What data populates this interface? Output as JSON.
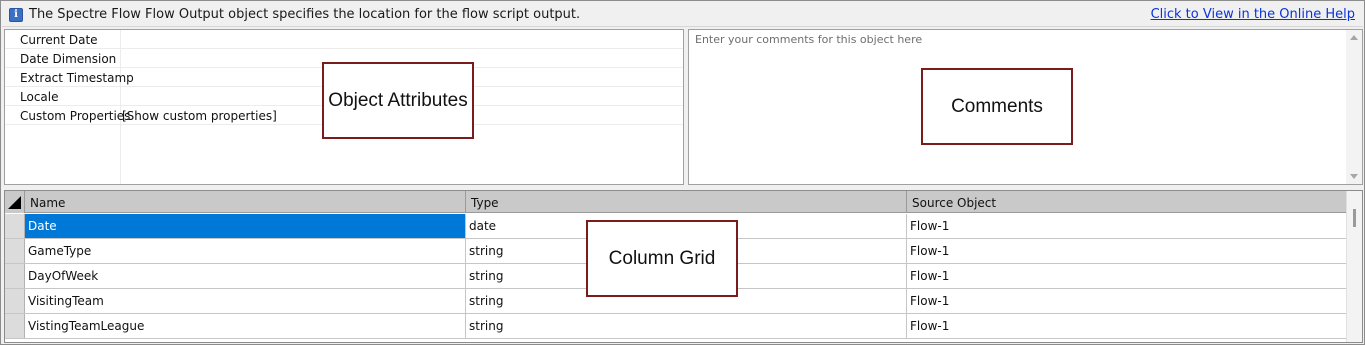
{
  "infobar": {
    "icon": "info-icon",
    "message": "The Spectre Flow Flow Output object specifies the location for the flow script output.",
    "help_link": "Click to View in the Online Help"
  },
  "attributes": {
    "rows": [
      {
        "key": "Current Date",
        "value": ""
      },
      {
        "key": "Date Dimension",
        "value": ""
      },
      {
        "key": "Extract Timestamp",
        "value": ""
      },
      {
        "key": "Locale",
        "value": ""
      },
      {
        "key": "Custom Properties",
        "value": "[Show custom properties]"
      }
    ]
  },
  "comments": {
    "placeholder": "Enter your comments for this object here"
  },
  "callouts": {
    "object_attributes": "Object Attributes",
    "comments": "Comments",
    "column_grid": "Column Grid"
  },
  "grid": {
    "columns": [
      "Name",
      "Type",
      "Source Object"
    ],
    "rows": [
      {
        "name": "Date",
        "type": "date",
        "source": "Flow-1",
        "selected": true
      },
      {
        "name": "GameType",
        "type": "string",
        "source": "Flow-1"
      },
      {
        "name": "DayOfWeek",
        "type": "string",
        "source": "Flow-1"
      },
      {
        "name": "VisitingTeam",
        "type": "string",
        "source": "Flow-1"
      },
      {
        "name": "VistingTeamLeague",
        "type": "string",
        "source": "Flow-1"
      }
    ]
  },
  "colors": {
    "selection": "#0078d7",
    "callout_border": "#7a1c1c",
    "link": "#0b33d6",
    "header_bg": "#c9c9c9"
  }
}
